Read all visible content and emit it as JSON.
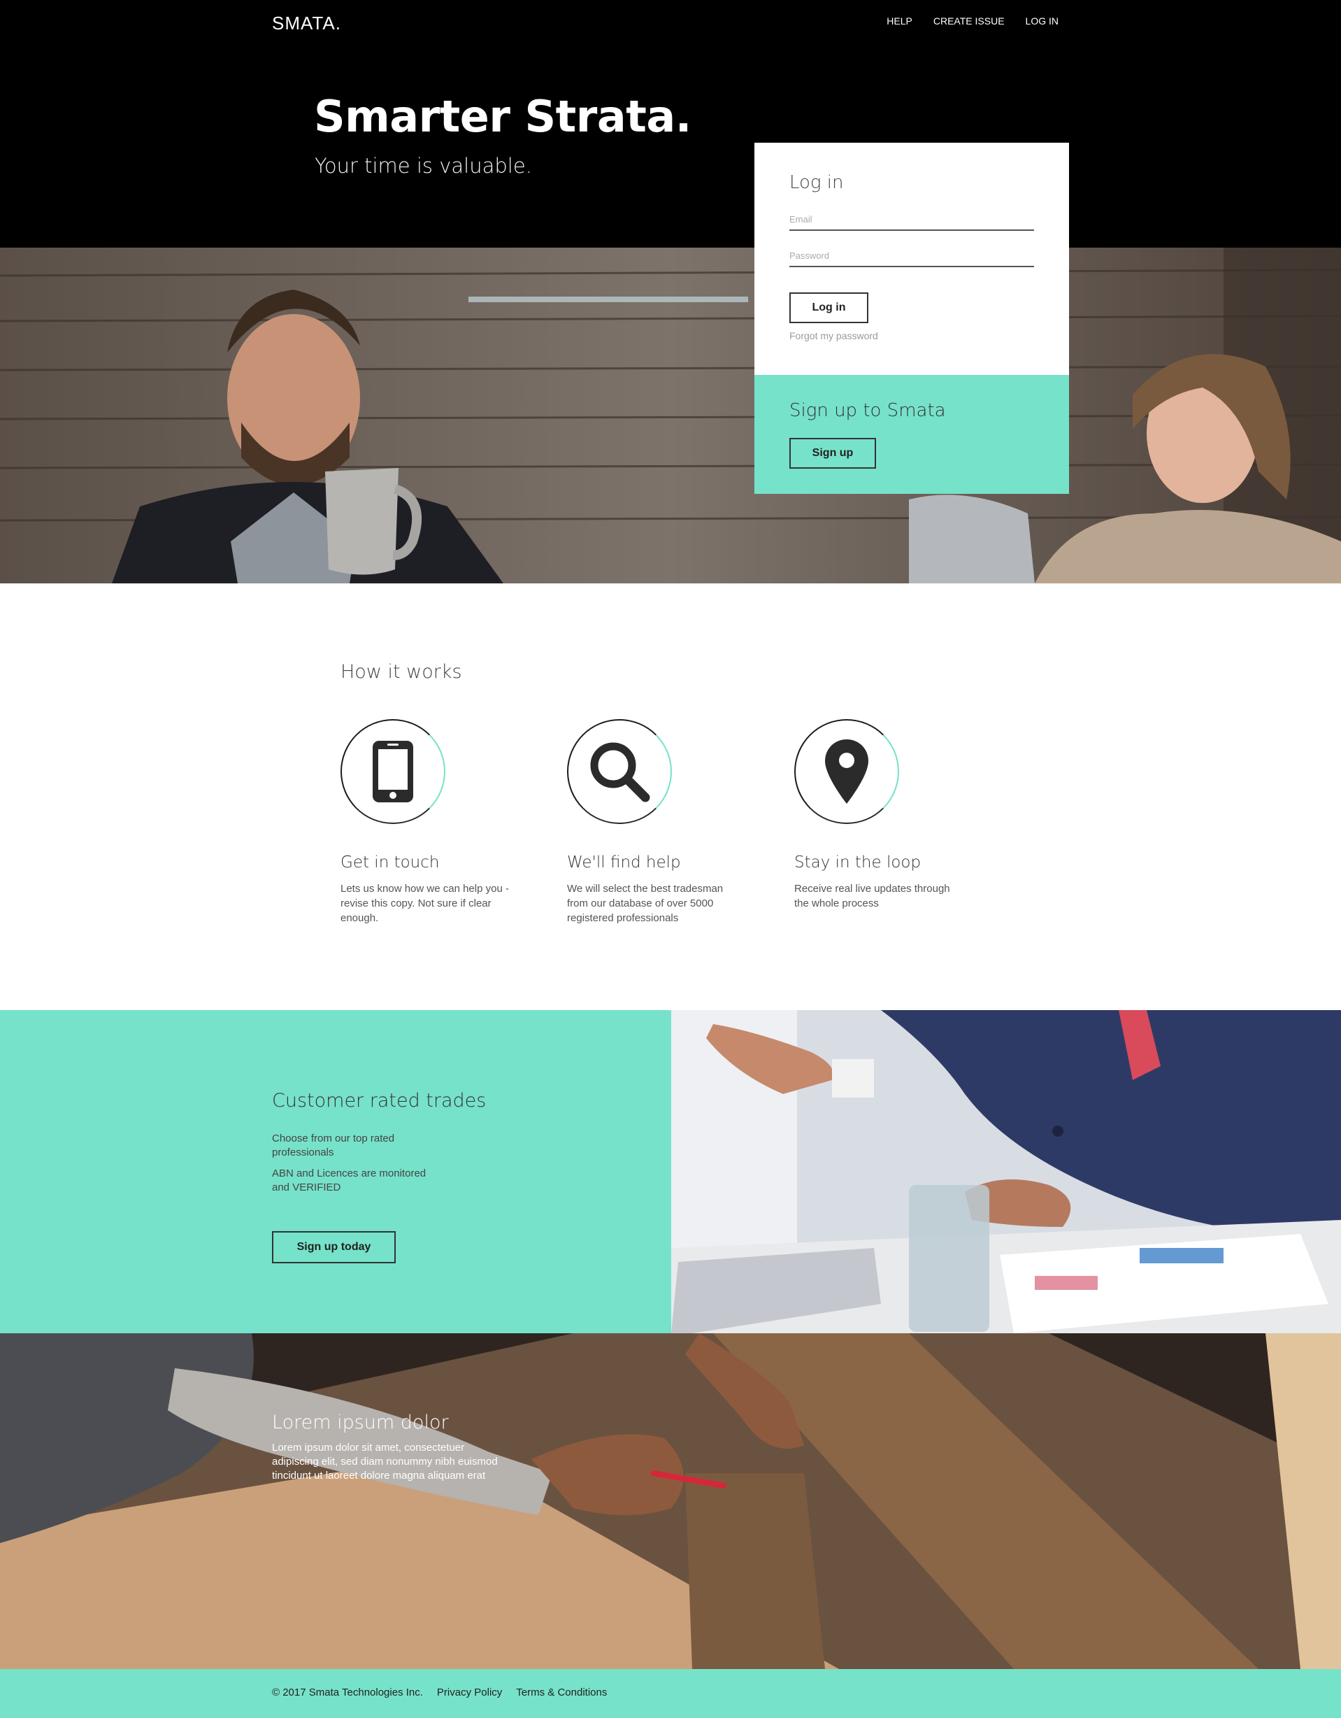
{
  "header": {
    "logo": "SMATA.",
    "nav": [
      "HELP",
      "CREATE ISSUE",
      "LOG IN"
    ]
  },
  "hero": {
    "title": "Smarter Strata.",
    "subtitle": "Your time is valuable."
  },
  "login": {
    "title": "Log in",
    "email_placeholder": "Email",
    "email_value": "",
    "password_placeholder": "Password",
    "password_value": "",
    "button": "Log in",
    "forgot": "Forgot my password"
  },
  "signup": {
    "title": "Sign up to Smata",
    "button": "Sign up"
  },
  "how_it_works": {
    "title": "How it works",
    "steps": [
      {
        "icon": "phone-icon",
        "title": "Get in touch",
        "text": "Lets us know how we can help you - revise this copy. Not sure if clear enough."
      },
      {
        "icon": "search-icon",
        "title": "We'll find help",
        "text": "We will select the best tradesman from our database of over 5000 registered professionals"
      },
      {
        "icon": "map-pin-icon",
        "title": "Stay in the loop",
        "text": "Receive real live updates through the whole process"
      }
    ]
  },
  "rated": {
    "title": "Customer rated trades",
    "p1": "Choose from our top rated professionals",
    "p2": "ABN and Licences are monitored and VERIFIED",
    "button": "Sign up today"
  },
  "lorem": {
    "title": "Lorem ipsum dolor",
    "text": "Lorem ipsum dolor sit amet, consectetuer adipiscing elit, sed diam nonummy nibh euismod tincidunt ut laoreet dolore magna aliquam erat"
  },
  "footer": {
    "copyright": "© 2017 Smata Technologies Inc.",
    "privacy": "Privacy Policy",
    "terms": "Terms & Conditions"
  },
  "colors": {
    "accent": "#76e2c9",
    "dark": "#000000"
  }
}
